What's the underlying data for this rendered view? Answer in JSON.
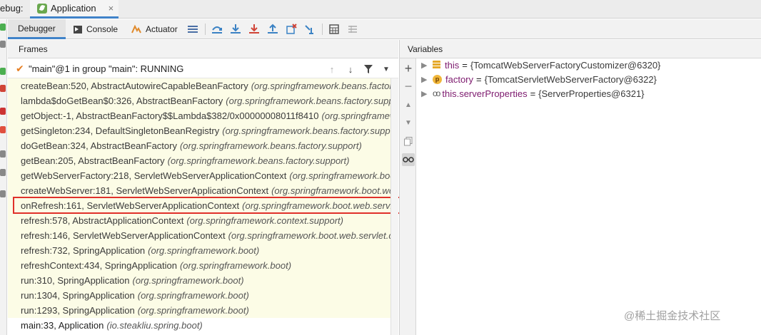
{
  "tab_bar": {
    "label": "ebug:",
    "app_tab": "Application",
    "close": "×"
  },
  "toolbar": {
    "debugger": "Debugger",
    "console": "Console",
    "actuator": "Actuator",
    "icons": [
      "menu-icon",
      "step-over-icon",
      "step-into-icon",
      "force-step-into-icon",
      "step-out-icon",
      "drop-frame-icon",
      "run-to-cursor-icon",
      "evaluate-icon",
      "trace-icon"
    ]
  },
  "frames": {
    "header": "Frames",
    "thread": "\"main\"@1 in group \"main\": RUNNING",
    "rows": [
      {
        "method": "createBean:520, AbstractAutowireCapableBeanFactory",
        "pkg": "(org.springframework.beans.factory.support)"
      },
      {
        "method": "lambda$doGetBean$0:326, AbstractBeanFactory",
        "pkg": "(org.springframework.beans.factory.support)"
      },
      {
        "method": "getObject:-1, AbstractBeanFactory$$Lambda$382/0x00000008011f8410",
        "pkg": "(org.springframework.beans.factory.support)"
      },
      {
        "method": "getSingleton:234, DefaultSingletonBeanRegistry",
        "pkg": "(org.springframework.beans.factory.support)"
      },
      {
        "method": "doGetBean:324, AbstractBeanFactory",
        "pkg": "(org.springframework.beans.factory.support)"
      },
      {
        "method": "getBean:205, AbstractBeanFactory",
        "pkg": "(org.springframework.beans.factory.support)"
      },
      {
        "method": "getWebServerFactory:218, ServletWebServerApplicationContext",
        "pkg": "(org.springframework.boot.web.servlet.context)"
      },
      {
        "method": "createWebServer:181, ServletWebServerApplicationContext",
        "pkg": "(org.springframework.boot.web.servlet.context)"
      },
      {
        "method": "onRefresh:161, ServletWebServerApplicationContext",
        "pkg": "(org.springframework.boot.web.servlet.context)"
      },
      {
        "method": "refresh:578, AbstractApplicationContext",
        "pkg": "(org.springframework.context.support)"
      },
      {
        "method": "refresh:146, ServletWebServerApplicationContext",
        "pkg": "(org.springframework.boot.web.servlet.context)"
      },
      {
        "method": "refresh:732, SpringApplication",
        "pkg": "(org.springframework.boot)"
      },
      {
        "method": "refreshContext:434, SpringApplication",
        "pkg": "(org.springframework.boot)"
      },
      {
        "method": "run:310, SpringApplication",
        "pkg": "(org.springframework.boot)"
      },
      {
        "method": "run:1304, SpringApplication",
        "pkg": "(org.springframework.boot)"
      },
      {
        "method": "run:1293, SpringApplication",
        "pkg": "(org.springframework.boot)"
      },
      {
        "method": "main:33, Application",
        "pkg": "(io.steakliu.spring.boot)"
      }
    ],
    "highlighted_index": 8
  },
  "variables": {
    "header": "Variables",
    "items": [
      {
        "name": "this",
        "value": "{TomcatWebServerFactoryCustomizer@6320}",
        "icon": "field-icon"
      },
      {
        "name": "factory",
        "value": "{TomcatServletWebServerFactory@6322}",
        "icon": "parameter-icon"
      },
      {
        "name": "this.serverProperties",
        "value": "{ServerProperties@6321}",
        "icon": "watch-icon"
      }
    ],
    "p_badge": "p"
  },
  "watermark": "@稀土掘金技术社区",
  "colors": {
    "accent": "#4083c9",
    "frame_bg": "#fcfce6",
    "highlight": "#e0302a",
    "var_name": "#7d1a6e"
  }
}
